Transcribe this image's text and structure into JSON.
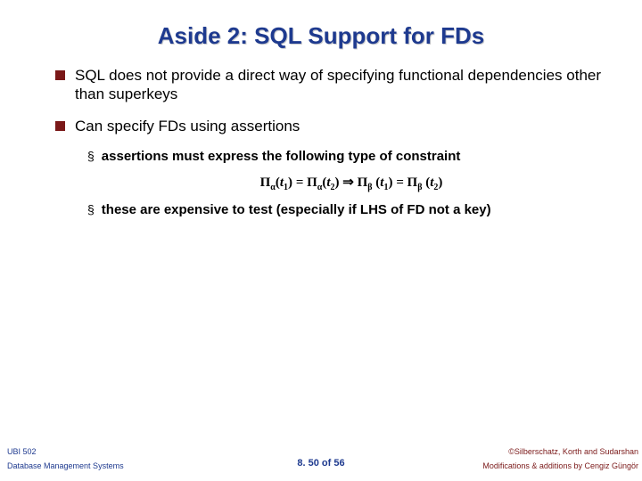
{
  "title": "Aside 2: SQL Support for FDs",
  "bullets": [
    {
      "text": "SQL does not provide a direct way of specifying functional dependencies other than superkeys"
    },
    {
      "text": "Can specify FDs using assertions"
    }
  ],
  "sub": [
    {
      "text": "assertions must express the following type of constraint"
    },
    {
      "text": "these are expensive to test (especially if LHS of FD not a key)"
    }
  ],
  "formula": {
    "pi": "Π",
    "alpha": "α",
    "beta": "β",
    "t1": "t",
    "s1": "1",
    "t2": "t",
    "s2": "2",
    "eq": " = ",
    "imp": "  ⇒  "
  },
  "footer": {
    "leftTop": "UBI 502",
    "leftBot": "Database Management Systems",
    "center": "8. 50 of 56",
    "rightTop": "©Silberschatz, Korth and Sudarshan",
    "rightBot": "Modifications & additions by Cengiz Güngör"
  }
}
